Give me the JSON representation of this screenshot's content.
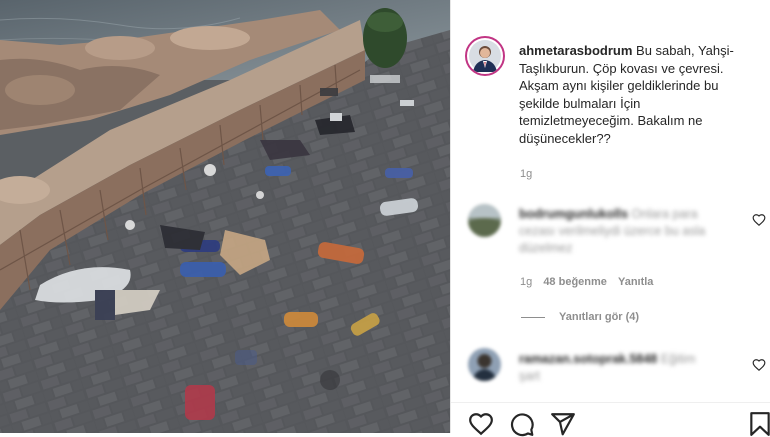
{
  "post": {
    "username": "ahmetarasbodrum",
    "caption": [
      "Bu sabah, Yahşi-",
      "Taşlıkburun. Çöp kovası ve çevresi.",
      "Akşam aynı kişiler geldiklerinde bu",
      "şekilde bulmaları İçin",
      "temizletmeyeceğim. Bakalım ne",
      "düşünecekler??"
    ],
    "time": "1g"
  },
  "comments": [
    {
      "username": "bodrumgunlukolls",
      "text_lines": [
        "Onlara para",
        "cezası verilmeliydi üzerce bu asla",
        "düzelmez"
      ],
      "time": "1g",
      "likes": "48 beğenme",
      "reply": "Yanıtla",
      "view_replies": "Yanıtları gör (4)"
    },
    {
      "username": "ramazan.sotoprak.5848",
      "text_lines": [
        "Eğitim",
        "şart"
      ]
    }
  ],
  "icons": {
    "like": "heart-icon",
    "comment": "comment-icon",
    "share": "send-icon",
    "save": "bookmark-icon"
  },
  "colors": {
    "text": "#262626",
    "muted": "#8e8e8e",
    "story_ring": "#c13584"
  }
}
